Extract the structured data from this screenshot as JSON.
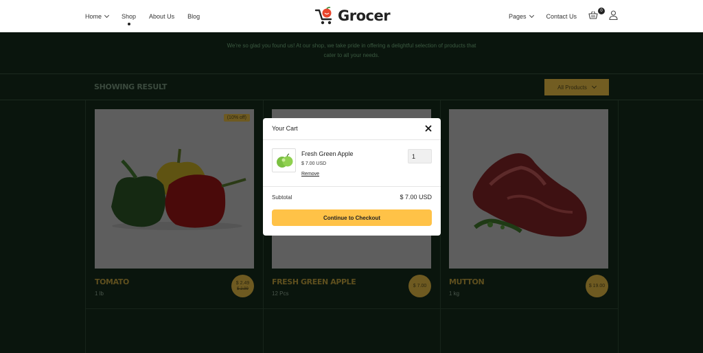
{
  "header": {
    "nav_left": [
      {
        "label": "Home",
        "has_dropdown": true
      },
      {
        "label": "Shop",
        "active": true
      },
      {
        "label": "About Us"
      },
      {
        "label": "Blog"
      }
    ],
    "logo_text": "Grocer",
    "nav_right": [
      {
        "label": "Pages",
        "has_dropdown": true
      },
      {
        "label": "Contact Us"
      }
    ],
    "cart_count": "0",
    "icons": {
      "cart": "basket-icon",
      "user": "user-icon"
    }
  },
  "intro": {
    "text": "We're so glad you found us! At our shop, we take pride in offering a delightful selection of products that cater to all your needs."
  },
  "results": {
    "title": "SHOWING RESULT",
    "filter_label": "All Products"
  },
  "products": [
    {
      "name": "TOMATO",
      "unit": "1 lb",
      "price": "$ 2.49",
      "old_price": "$ 2.99",
      "discount": "(10% off)"
    },
    {
      "name": "FRESH GREEN APPLE",
      "unit": "12 Pcs",
      "price": "$ 7.00"
    },
    {
      "name": "MUTTON",
      "unit": "1 kg",
      "price": "$ 19.00"
    }
  ],
  "cart_modal": {
    "title": "Your Cart",
    "item": {
      "name": "Fresh Green Apple",
      "price": "$ 7.00 USD",
      "remove_label": "Remove",
      "quantity": "1"
    },
    "subtotal_label": "Subtotal",
    "subtotal_value": "$ 7.00 USD",
    "checkout_label": "Continue to Checkout"
  },
  "colors": {
    "page_background": "#0a150d",
    "accent": "#ffc247",
    "dimmed_accent": "#6e5a21"
  }
}
